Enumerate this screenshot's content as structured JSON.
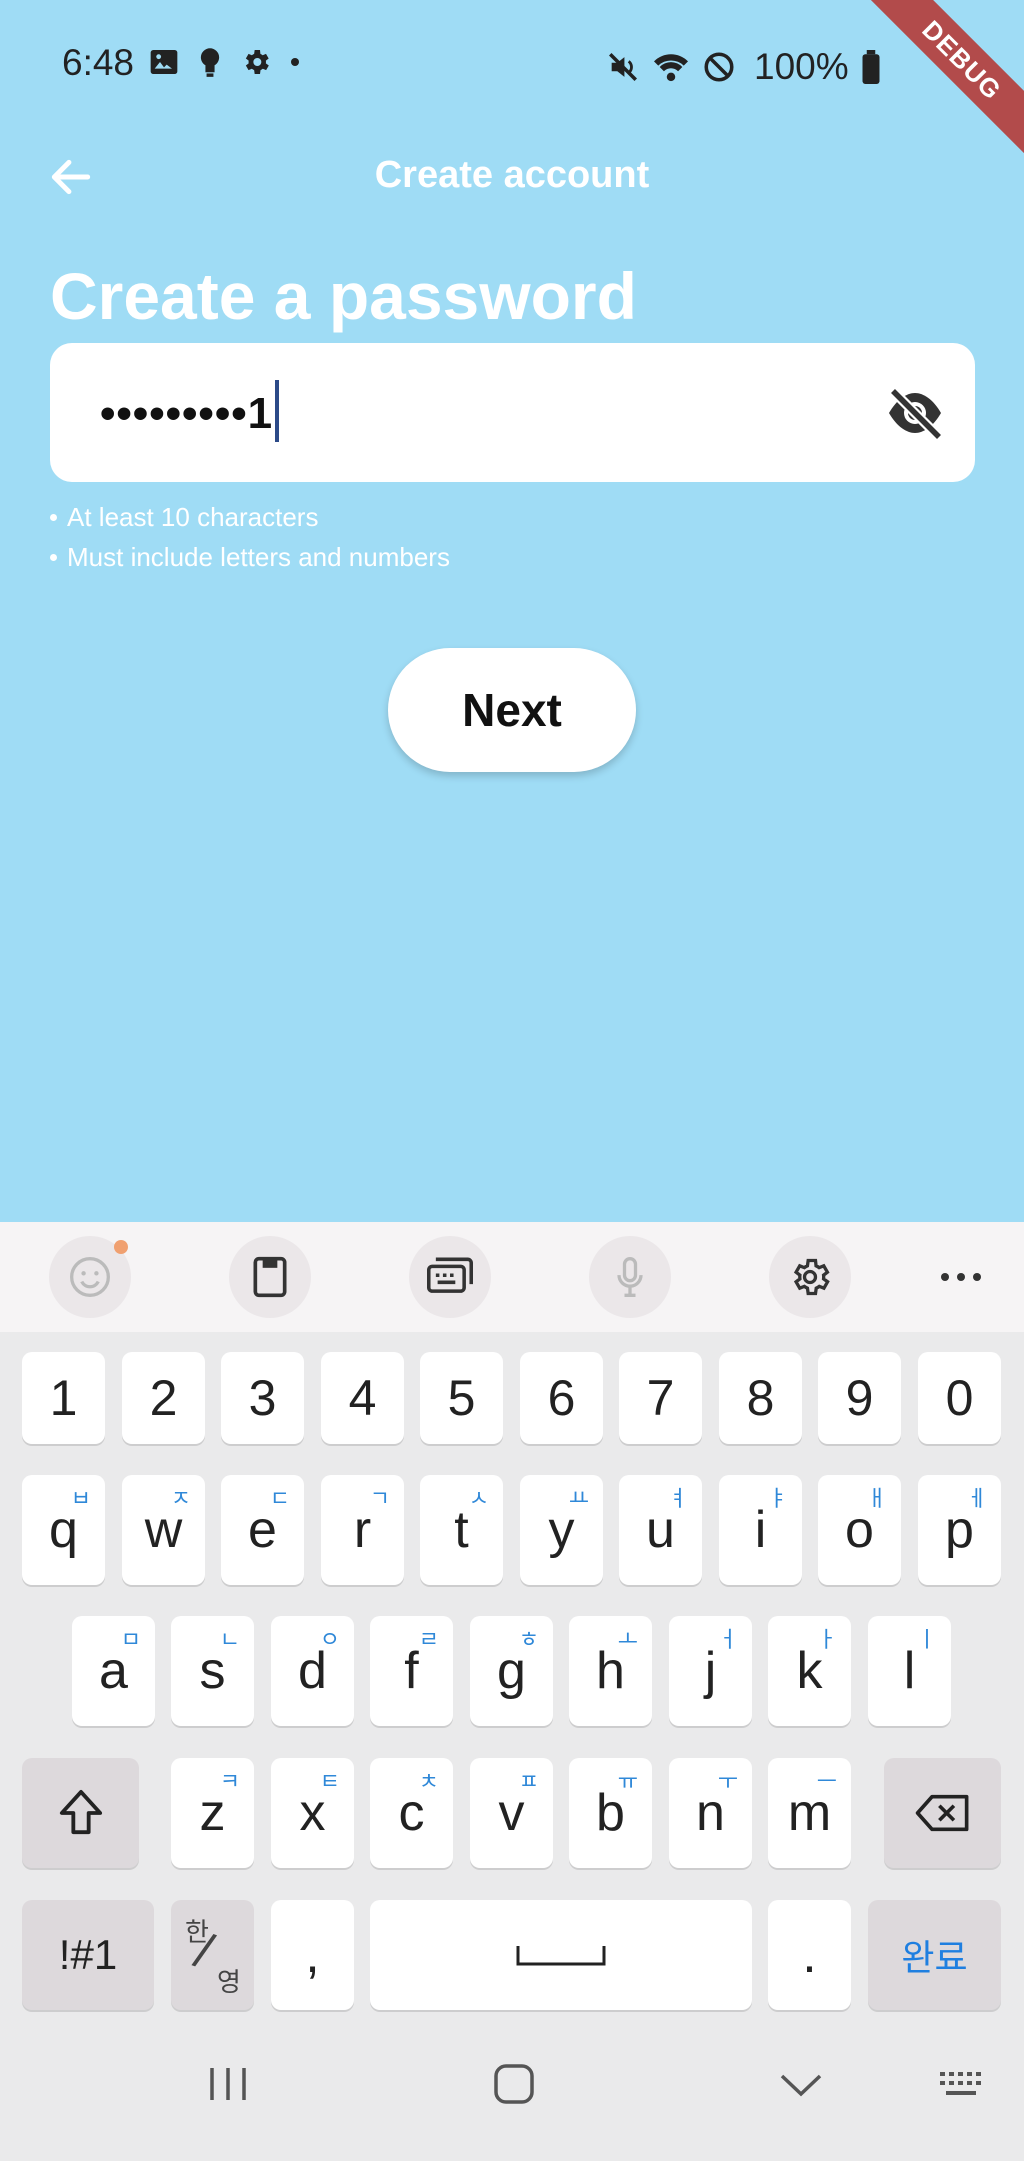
{
  "status": {
    "time": "6:48",
    "battery": "100%"
  },
  "debug_label": "DEBUG",
  "appbar": {
    "title": "Create account"
  },
  "heading": "Create a password",
  "password_field": {
    "masked_value": "•••••••••1"
  },
  "hints": [
    "At least 10 characters",
    "Must include letters and numbers"
  ],
  "next_button": "Next",
  "keyboard": {
    "numbers": [
      "1",
      "2",
      "3",
      "4",
      "5",
      "6",
      "7",
      "8",
      "9",
      "0"
    ],
    "row1": [
      {
        "k": "q",
        "h": "ㅂ"
      },
      {
        "k": "w",
        "h": "ㅈ"
      },
      {
        "k": "e",
        "h": "ㄷ"
      },
      {
        "k": "r",
        "h": "ㄱ"
      },
      {
        "k": "t",
        "h": "ㅅ"
      },
      {
        "k": "y",
        "h": "ㅛ"
      },
      {
        "k": "u",
        "h": "ㅕ"
      },
      {
        "k": "i",
        "h": "ㅑ"
      },
      {
        "k": "o",
        "h": "ㅐ"
      },
      {
        "k": "p",
        "h": "ㅔ"
      }
    ],
    "row2": [
      {
        "k": "a",
        "h": "ㅁ"
      },
      {
        "k": "s",
        "h": "ㄴ"
      },
      {
        "k": "d",
        "h": "ㅇ"
      },
      {
        "k": "f",
        "h": "ㄹ"
      },
      {
        "k": "g",
        "h": "ㅎ"
      },
      {
        "k": "h",
        "h": "ㅗ"
      },
      {
        "k": "j",
        "h": "ㅓ"
      },
      {
        "k": "k",
        "h": "ㅏ"
      },
      {
        "k": "l",
        "h": "ㅣ"
      }
    ],
    "row3": [
      {
        "k": "z",
        "h": "ㅋ"
      },
      {
        "k": "x",
        "h": "ㅌ"
      },
      {
        "k": "c",
        "h": "ㅊ"
      },
      {
        "k": "v",
        "h": "ㅍ"
      },
      {
        "k": "b",
        "h": "ㅠ"
      },
      {
        "k": "n",
        "h": "ㅜ"
      },
      {
        "k": "m",
        "h": "ㅡ"
      }
    ],
    "symbols_key": "!#1",
    "lang_key_top": "한",
    "lang_key_bottom": "영",
    "comma_key": ",",
    "period_key": ".",
    "done_key": "완료"
  }
}
